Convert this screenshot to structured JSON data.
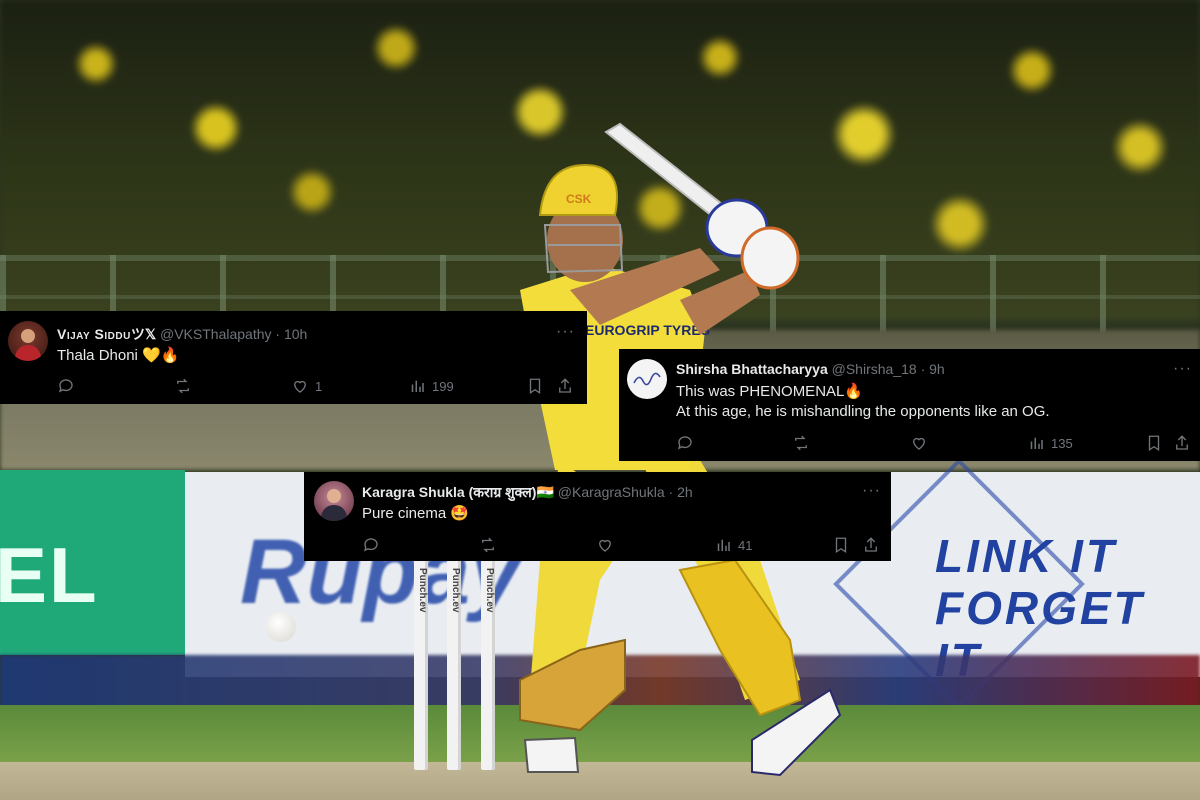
{
  "tweets": [
    {
      "name": "Vijay Siddu",
      "name_suffix": "ツ𝕏",
      "handle": "@VKSThalapathy",
      "sep": "·",
      "time": "10h",
      "text": "Thala Dhoni 💛🔥",
      "likes": "1",
      "views": "199"
    },
    {
      "name": "Shirsha Bhattacharyya",
      "handle": "@Shirsha_18",
      "sep": "·",
      "time": "9h",
      "text_line1": "This was PHENOMENAL🔥",
      "text_line2": "At this age, he is mishandling the opponents like an OG.",
      "likes": "",
      "views": "135"
    },
    {
      "name": "Karagra Shukla (कराग्र शुक्ल)🇮🇳",
      "handle": "@KaragraShukla",
      "sep": "·",
      "time": "2h",
      "text": "Pure cinema 🤩",
      "likes": "",
      "views": "41"
    }
  ],
  "background": {
    "board_left_text": "EL",
    "board_brand_text": "Rupay",
    "board_right_line1": "LINK IT",
    "board_right_line2": "FORGET IT",
    "stump_text": "Punch.ev",
    "helmet_text": "CSK",
    "shirt_text": "EUROGRIP TYRES"
  },
  "colors": {
    "tweet_bg": "#000000",
    "text_primary": "#e7e9ea",
    "text_secondary": "#71767b",
    "csk_yellow": "#f2dd3a"
  }
}
